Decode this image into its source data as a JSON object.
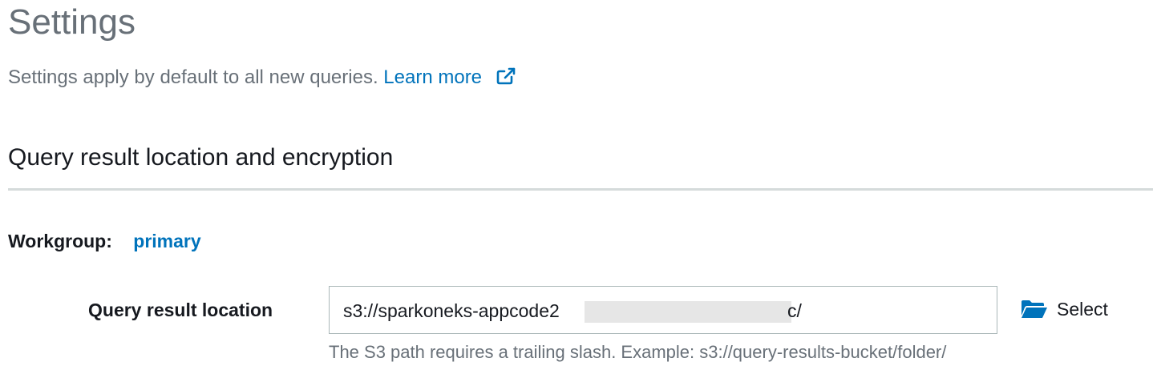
{
  "header": {
    "title": "Settings",
    "subtitle": "Settings apply by default to all new queries.",
    "learn_more_label": "Learn more",
    "learn_more_icon": "external-link-icon"
  },
  "section": {
    "title": "Query result location and encryption"
  },
  "workgroup": {
    "label": "Workgroup:",
    "value": "primary"
  },
  "query_result_location": {
    "label": "Query result location",
    "value_prefix": "s3://sparkoneks-appcode2",
    "value_suffix": "c/",
    "select_label": "Select",
    "select_icon": "folder-open-icon",
    "hint": "The S3 path requires a trailing slash. Example: s3://query-results-bucket/folder/"
  },
  "colors": {
    "link": "#0073bb",
    "muted_text": "#687078",
    "text": "#16191f",
    "divider": "#d5dbdb",
    "input_border": "#aab7b8",
    "redaction": "#e6e6e6"
  }
}
